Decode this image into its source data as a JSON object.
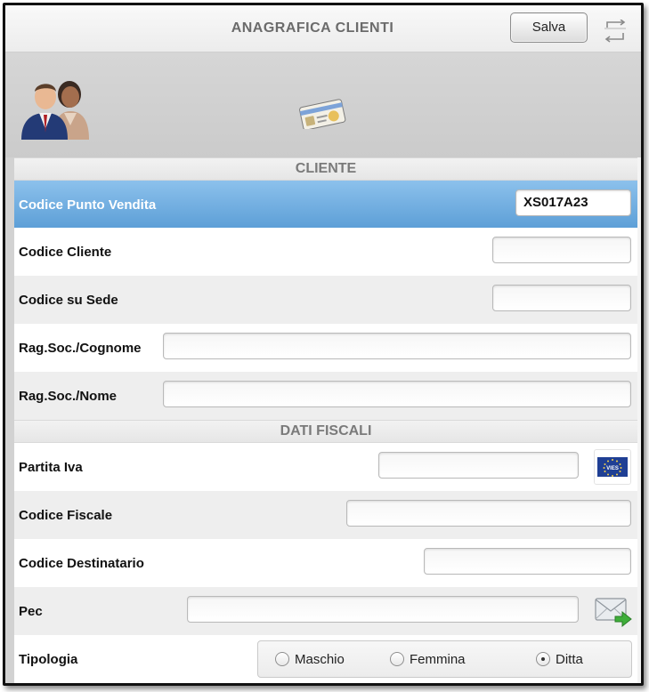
{
  "header": {
    "title": "ANAGRAFICA CLIENTI",
    "save_label": "Salva"
  },
  "icons": {
    "banner_left": "customers-icon",
    "banner_center": "id-card-icon",
    "header_right": "rotate-screen-icon"
  },
  "sections": {
    "cliente": "CLIENTE",
    "dati_fiscali": "DATI FISCALI"
  },
  "cliente": {
    "codice_punto_vendita": {
      "label": "Codice Punto Vendita",
      "value": "XS017A23"
    },
    "codice_cliente": {
      "label": "Codice Cliente",
      "value": ""
    },
    "codice_su_sede": {
      "label": "Codice su Sede",
      "value": ""
    },
    "rag_soc_cognome": {
      "label": "Rag.Soc./Cognome",
      "value": ""
    },
    "rag_soc_nome": {
      "label": "Rag.Soc./Nome",
      "value": ""
    }
  },
  "fiscali": {
    "partita_iva": {
      "label": "Partita Iva",
      "value": "",
      "button": "VIES"
    },
    "codice_fiscale": {
      "label": "Codice Fiscale",
      "value": ""
    },
    "codice_destinatario": {
      "label": "Codice Destinatario",
      "value": ""
    },
    "pec": {
      "label": "Pec",
      "value": ""
    },
    "tipologia": {
      "label": "Tipologia",
      "options": [
        "Maschio",
        "Femmina",
        "Ditta"
      ],
      "selected": "Ditta"
    }
  },
  "colors": {
    "highlight": "#6aa9dc",
    "eu_blue": "#1f3f94"
  }
}
